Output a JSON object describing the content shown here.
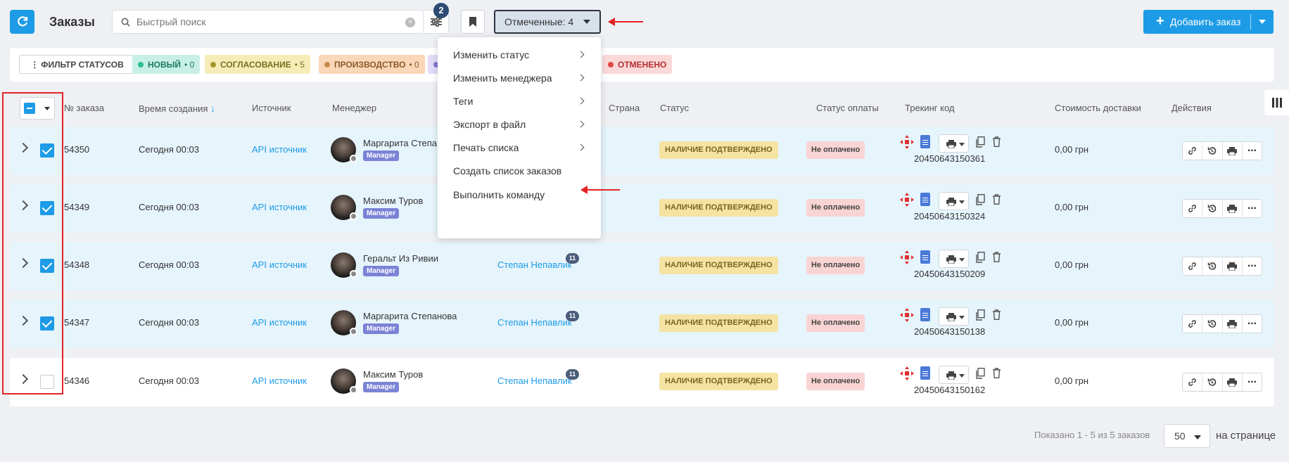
{
  "header": {
    "title": "Заказы",
    "search_placeholder": "Быстрый поиск",
    "filter_count": "2",
    "marked_label": "Отмеченные: 4",
    "add_order_label": "Добавить заказ"
  },
  "status_filter": {
    "button_label": "ФИЛЬТР СТАТУСОВ",
    "chips": [
      {
        "label": "НОВЫЙ",
        "count": "• 0",
        "bg": "#c8efe6",
        "dot": "#2dbd96",
        "color": "#1a7a60"
      },
      {
        "label": "СОГЛАСОВАНИЕ",
        "count": "• 5",
        "bg": "#f6ecb8",
        "dot": "#a4952a",
        "color": "#7a6e20"
      },
      {
        "label": "ПРОИЗВОДСТВО",
        "count": "• 0",
        "bg": "#fad7b8",
        "dot": "#c88a4a",
        "color": "#8a5a26"
      },
      {
        "label": "",
        "count": "",
        "bg": "#e2dcf7",
        "dot": "#8b76d6",
        "color": "#5a4aa8"
      },
      {
        "label": "ОТМЕНЕНО",
        "count": "",
        "bg": "#fcd9d9",
        "dot": "#e04848",
        "color": "#b23030"
      }
    ]
  },
  "table": {
    "headers": {
      "order_no": "№ заказа",
      "created": "Время создания",
      "source": "Источник",
      "manager": "Менеджер",
      "country": "Страна",
      "status": "Статус",
      "payment_status": "Статус оплаты",
      "tracking": "Трекинг код",
      "delivery_cost": "Стоимость доставки",
      "actions": "Действия"
    },
    "rows": [
      {
        "order": "54350",
        "created": "Сегодня 00:03",
        "source": "API источник",
        "manager": "Маргарита Степа",
        "role": "Manager",
        "note": "",
        "note_count": "",
        "status": "НАЛИЧИЕ ПОДТВЕРЖДЕНО",
        "payment": "Не оплачено",
        "tracking": "20450643150361",
        "delivery": "0,00 грн",
        "checked": true
      },
      {
        "order": "54349",
        "created": "Сегодня 00:03",
        "source": "API источник",
        "manager": "Максим Туров",
        "role": "Manager",
        "note": "",
        "note_count": "",
        "status": "НАЛИЧИЕ ПОДТВЕРЖДЕНО",
        "payment": "Не оплачено",
        "tracking": "20450643150324",
        "delivery": "0,00 грн",
        "checked": true
      },
      {
        "order": "54348",
        "created": "Сегодня 00:03",
        "source": "API источник",
        "manager": "Геральт Из Ривии",
        "role": "Manager",
        "note": "Степан Непавлик",
        "note_count": "11",
        "status": "НАЛИЧИЕ ПОДТВЕРЖДЕНО",
        "payment": "Не оплачено",
        "tracking": "20450643150209",
        "delivery": "0,00 грн",
        "checked": true
      },
      {
        "order": "54347",
        "created": "Сегодня 00:03",
        "source": "API источник",
        "manager": "Маргарита Степанова",
        "role": "Manager",
        "note": "Степан Непавлик",
        "note_count": "11",
        "status": "НАЛИЧИЕ ПОДТВЕРЖДЕНО",
        "payment": "Не оплачено",
        "tracking": "20450643150138",
        "delivery": "0,00 грн",
        "checked": true
      },
      {
        "order": "54346",
        "created": "Сегодня 00:03",
        "source": "API источник",
        "manager": "Максим Туров",
        "role": "Manager",
        "note": "Степан Непавлик",
        "note_count": "11",
        "status": "НАЛИЧИЕ ПОДТВЕРЖДЕНО",
        "payment": "Не оплачено",
        "tracking": "20450643150162",
        "delivery": "0,00 грн",
        "checked": false
      }
    ]
  },
  "dropdown": {
    "items": [
      {
        "label": "Изменить статус",
        "submenu": true
      },
      {
        "label": "Изменить менеджера",
        "submenu": true
      },
      {
        "label": "Теги",
        "submenu": true
      },
      {
        "label": "Экспорт в файл",
        "submenu": true
      },
      {
        "label": "Печать списка",
        "submenu": true
      },
      {
        "label": "Создать список заказов",
        "submenu": false
      },
      {
        "label": "Выполнить команду",
        "submenu": false
      }
    ]
  },
  "footer": {
    "shown": "Показано 1 - 5 из 5 заказов",
    "per_page_value": "50",
    "per_page_label": "на странице"
  },
  "colors": {
    "accent": "#1d9be6",
    "annotation": "#e42323"
  }
}
